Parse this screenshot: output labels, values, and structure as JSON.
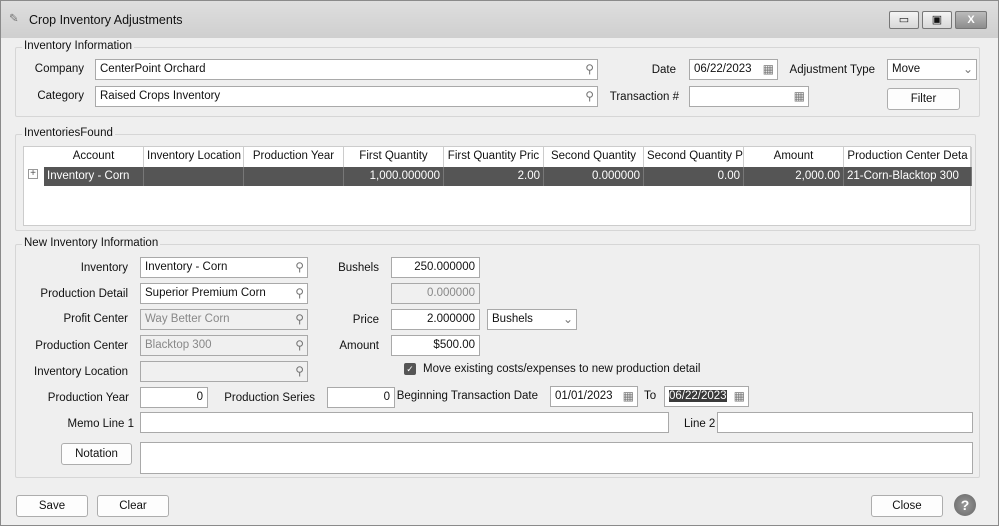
{
  "window": {
    "title": "Crop Inventory Adjustments",
    "min": "▭",
    "max": "▣",
    "close": "X"
  },
  "inventory_info": {
    "legend": "Inventory Information",
    "company_label": "Company",
    "company": "CenterPoint Orchard",
    "category_label": "Category",
    "category": "Raised Crops Inventory",
    "date_label": "Date",
    "date": "06/22/2023",
    "adjustment_type_label": "Adjustment Type",
    "adjustment_type": "Move",
    "transaction_label": "Transaction #",
    "transaction": "",
    "filter": "Filter"
  },
  "found": {
    "legend": "InventoriesFound",
    "columns": [
      "Account",
      "Inventory Location",
      "Production Year",
      "First Quantity",
      "First Quantity Pric",
      "Second Quantity",
      "Second Quantity P",
      "Amount",
      "Production Center Deta"
    ],
    "rows": [
      [
        "Inventory -  Corn",
        "",
        "",
        "1,000.000000",
        "2.00",
        "0.000000",
        "0.00",
        "2,000.00",
        "21-Corn-Blacktop 300"
      ]
    ]
  },
  "new_info": {
    "legend": "New Inventory Information",
    "inventory_label": "Inventory",
    "inventory": "Inventory -  Corn",
    "production_detail_label": "Production Detail",
    "production_detail": "Superior Premium Corn",
    "profit_center_label": "Profit Center",
    "profit_center": "Way Better Corn",
    "production_center_label": "Production Center",
    "production_center": "Blacktop 300",
    "inventory_location_label": "Inventory Location",
    "inventory_location": "",
    "bushels_label": "Bushels",
    "bushels": "250.000000",
    "second_qty": "0.000000",
    "price_label": "Price",
    "price": "2.000000",
    "unit": "Bushels",
    "amount_label": "Amount",
    "amount": "$500.00",
    "move_costs_label": "Move existing costs/expenses to new production detail",
    "move_costs_checked": true,
    "production_year_label": "Production Year",
    "production_year": "0",
    "production_series_label": "Production Series",
    "production_series": "0",
    "begin_date_label": "Beginning Transaction Date",
    "begin_date": "01/01/2023",
    "to_label": "To",
    "end_date": "06/22/2023",
    "memo1_label": "Memo Line 1",
    "memo1": "",
    "line2_label": "Line 2",
    "line2": "",
    "notation": "Notation",
    "notation_text": ""
  },
  "footer": {
    "save": "Save",
    "clear": "Clear",
    "close": "Close",
    "help": "?"
  }
}
